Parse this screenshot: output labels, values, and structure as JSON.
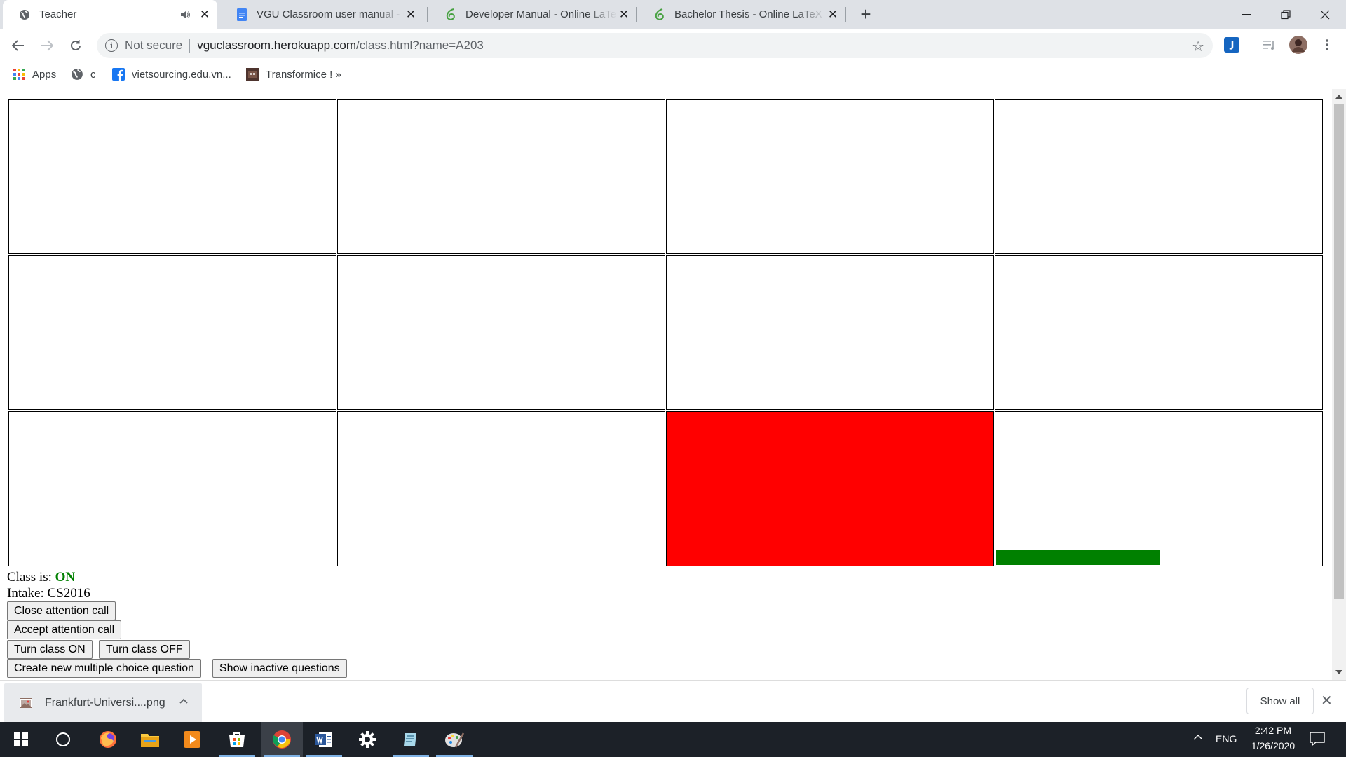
{
  "browser": {
    "tabs": [
      {
        "title": "Teacher",
        "active": true,
        "audio": true
      },
      {
        "title": "VGU Classroom user manual - Go",
        "active": false
      },
      {
        "title": "Developer Manual - Online LaTeX",
        "active": false
      },
      {
        "title": "Bachelor Thesis - Online LaTeX Ec",
        "active": false
      }
    ],
    "address": {
      "security_label": "Not secure",
      "host": "vguclassroom.herokuapp.com",
      "path": "/class.html?name=A203"
    },
    "bookmarks": [
      {
        "label": "Apps",
        "icon": "apps-grid-icon"
      },
      {
        "label": "c",
        "icon": "globe-icon"
      },
      {
        "label": "vietsourcing.edu.vn...",
        "icon": "facebook-icon"
      },
      {
        "label": "Transformice ! »",
        "icon": "game-icon"
      }
    ]
  },
  "page": {
    "seats": {
      "rows": 3,
      "cols": 4,
      "alert_seat": 11,
      "progress_seat": 12,
      "progress_fraction": 0.5,
      "alert_color": "#ff0000",
      "progress_color": "#008000"
    },
    "status": {
      "class_label": "Class is:",
      "class_value": "ON",
      "intake_label": "Intake:",
      "intake_value": "CS2016"
    },
    "buttons": {
      "close_attention": "Close attention call",
      "accept_attention": "Accept attention call",
      "turn_on": "Turn class ON",
      "turn_off": "Turn class OFF",
      "create_mcq": "Create new multiple choice question",
      "show_inactive": "Show inactive questions"
    }
  },
  "downloads": {
    "file_name": "Frankfurt-Universi....png",
    "show_all": "Show all"
  },
  "taskbar": {
    "language": "ENG",
    "time": "2:42 PM",
    "date": "1/26/2020"
  }
}
